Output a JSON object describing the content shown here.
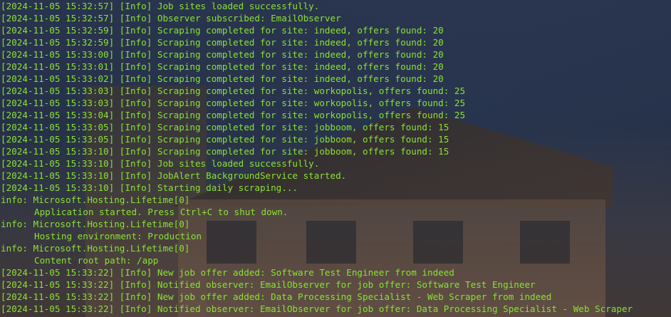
{
  "terminal": {
    "text_color": "#8ae234",
    "lines": [
      {
        "text": "[2024-11-05 15:32:57] [Info] Job sites loaded successfully."
      },
      {
        "text": "[2024-11-05 15:32:57] [Info] Observer subscribed: EmailObserver"
      },
      {
        "text": "[2024-11-05 15:32:59] [Info] Scraping completed for site: indeed, offers found: 20"
      },
      {
        "text": "[2024-11-05 15:32:59] [Info] Scraping completed for site: indeed, offers found: 20"
      },
      {
        "text": "[2024-11-05 15:33:00] [Info] Scraping completed for site: indeed, offers found: 20"
      },
      {
        "text": "[2024-11-05 15:33:01] [Info] Scraping completed for site: indeed, offers found: 20"
      },
      {
        "text": "[2024-11-05 15:33:02] [Info] Scraping completed for site: indeed, offers found: 20"
      },
      {
        "text": "[2024-11-05 15:33:03] [Info] Scraping completed for site: workopolis, offers found: 25"
      },
      {
        "text": "[2024-11-05 15:33:03] [Info] Scraping completed for site: workopolis, offers found: 25"
      },
      {
        "text": "[2024-11-05 15:33:04] [Info] Scraping completed for site: workopolis, offers found: 25"
      },
      {
        "text": "[2024-11-05 15:33:05] [Info] Scraping completed for site: jobboom, offers found: 15"
      },
      {
        "text": "[2024-11-05 15:33:05] [Info] Scraping completed for site: jobboom, offers found: 15"
      },
      {
        "text": "[2024-11-05 15:33:10] [Info] Scraping completed for site: jobboom, offers found: 15"
      },
      {
        "text": "[2024-11-05 15:33:10] [Info] Job sites loaded successfully."
      },
      {
        "text": "[2024-11-05 15:33:10] [Info] JobAlert BackgroundService started."
      },
      {
        "text": "[2024-11-05 15:33:10] [Info] Starting daily scraping..."
      },
      {
        "text": "info: Microsoft.Hosting.Lifetime[0]"
      },
      {
        "text": "Application started. Press Ctrl+C to shut down.",
        "indent": true
      },
      {
        "text": "info: Microsoft.Hosting.Lifetime[0]"
      },
      {
        "text": "Hosting environment: Production",
        "indent": true
      },
      {
        "text": "info: Microsoft.Hosting.Lifetime[0]"
      },
      {
        "text": "Content root path: /app",
        "indent": true
      },
      {
        "text": "[2024-11-05 15:33:22] [Info] New job offer added: Software Test Engineer from indeed"
      },
      {
        "text": "[2024-11-05 15:33:22] [Info] Notified observer: EmailObserver for job offer: Software Test Engineer"
      },
      {
        "text": "[2024-11-05 15:33:22] [Info] New job offer added: Data Processing Specialist - Web Scraper from indeed"
      },
      {
        "text": "[2024-11-05 15:33:22] [Info] Notified observer: EmailObserver for job offer: Data Processing Specialist - Web Scraper"
      }
    ]
  }
}
